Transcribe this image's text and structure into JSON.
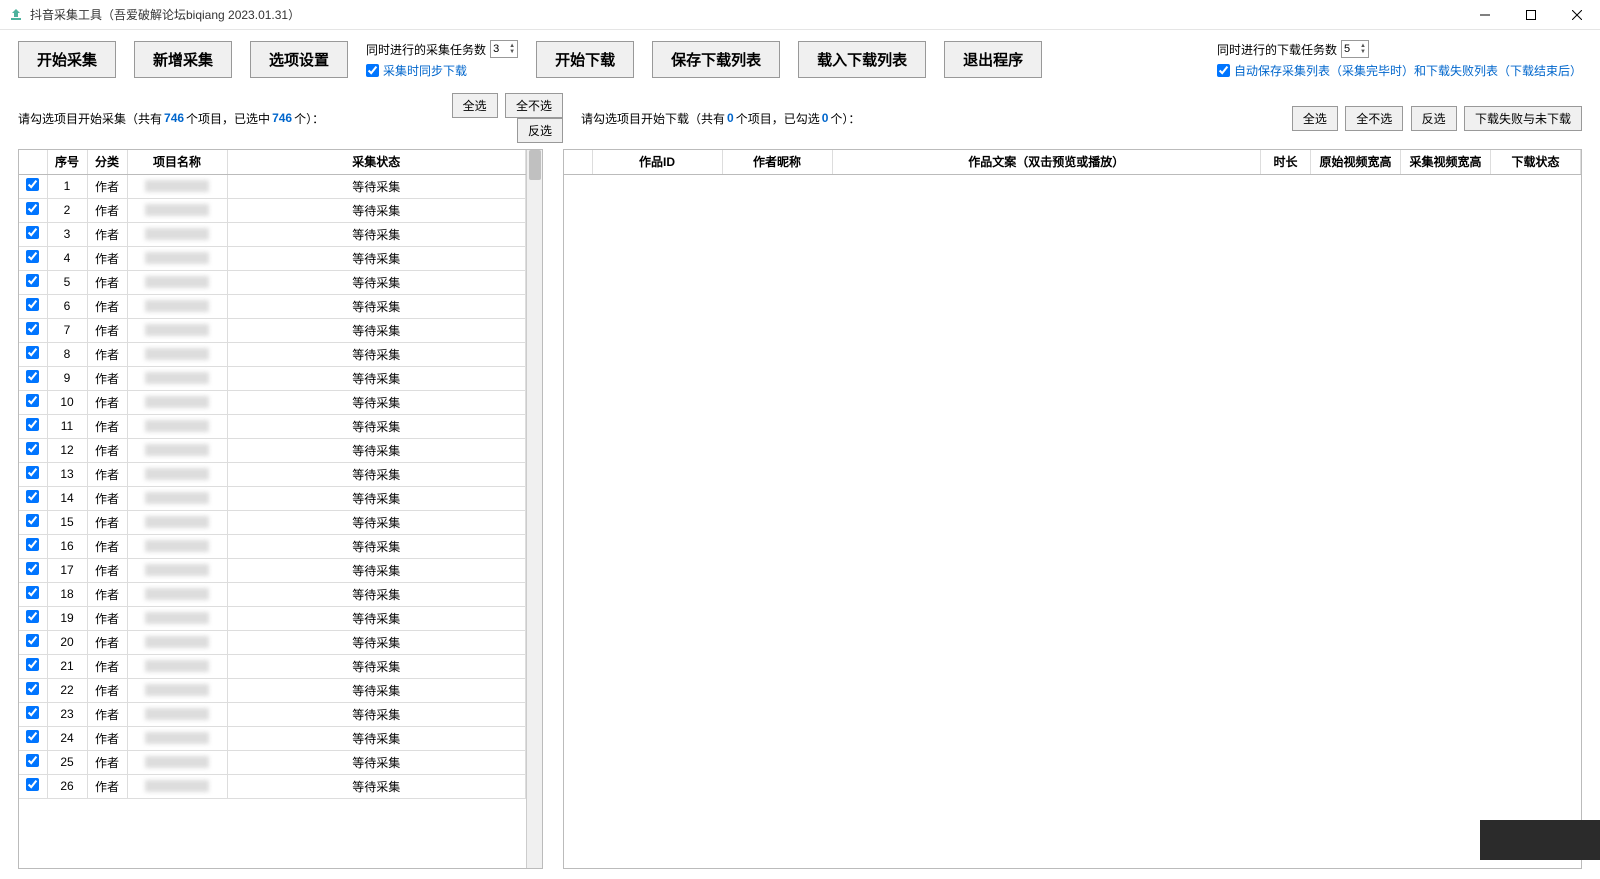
{
  "window": {
    "title": "抖音采集工具（吾爱破解论坛biqiang 2023.01.31）"
  },
  "toolbar_left": {
    "start_collect": "开始采集",
    "add_collect": "新增采集",
    "options": "选项设置",
    "task_count_label": "同时进行的采集任务数",
    "task_count_value": "3",
    "sync_download_label": "采集时同步下载"
  },
  "toolbar_right": {
    "start_download": "开始下载",
    "save_list": "保存下载列表",
    "load_list": "载入下载列表",
    "exit": "退出程序",
    "task_count_label": "同时进行的下载任务数",
    "task_count_value": "5",
    "auto_save_label": "自动保存采集列表（采集完毕时）和下载失败列表（下载结束后）"
  },
  "left_prompt": {
    "prefix": "请勾选项目开始采集（共有",
    "total": "746",
    "mid": "个项目，已选中",
    "selected": "746",
    "suffix": "个）："
  },
  "right_prompt": {
    "prefix": "请勾选项目开始下载（共有",
    "total": "0",
    "mid": "个项目，已勾选",
    "selected": "0",
    "suffix": "个）："
  },
  "buttons_small": {
    "select_all": "全选",
    "select_none": "全不选",
    "invert": "反选",
    "download_failed": "下载失败与未下载"
  },
  "left_table": {
    "headers": {
      "checkbox": "",
      "index": "序号",
      "category": "分类",
      "name": "项目名称",
      "status": "采集状态"
    },
    "row_defaults": {
      "category": "作者",
      "status": "等待采集"
    },
    "row_count": 26
  },
  "right_table": {
    "headers": {
      "checkbox": "",
      "work_id": "作品ID",
      "author": "作者昵称",
      "content": "作品文案（双击预览或播放）",
      "duration": "时长",
      "orig_size": "原始视频宽高",
      "collect_size": "采集视频宽高",
      "dl_status": "下载状态"
    }
  }
}
